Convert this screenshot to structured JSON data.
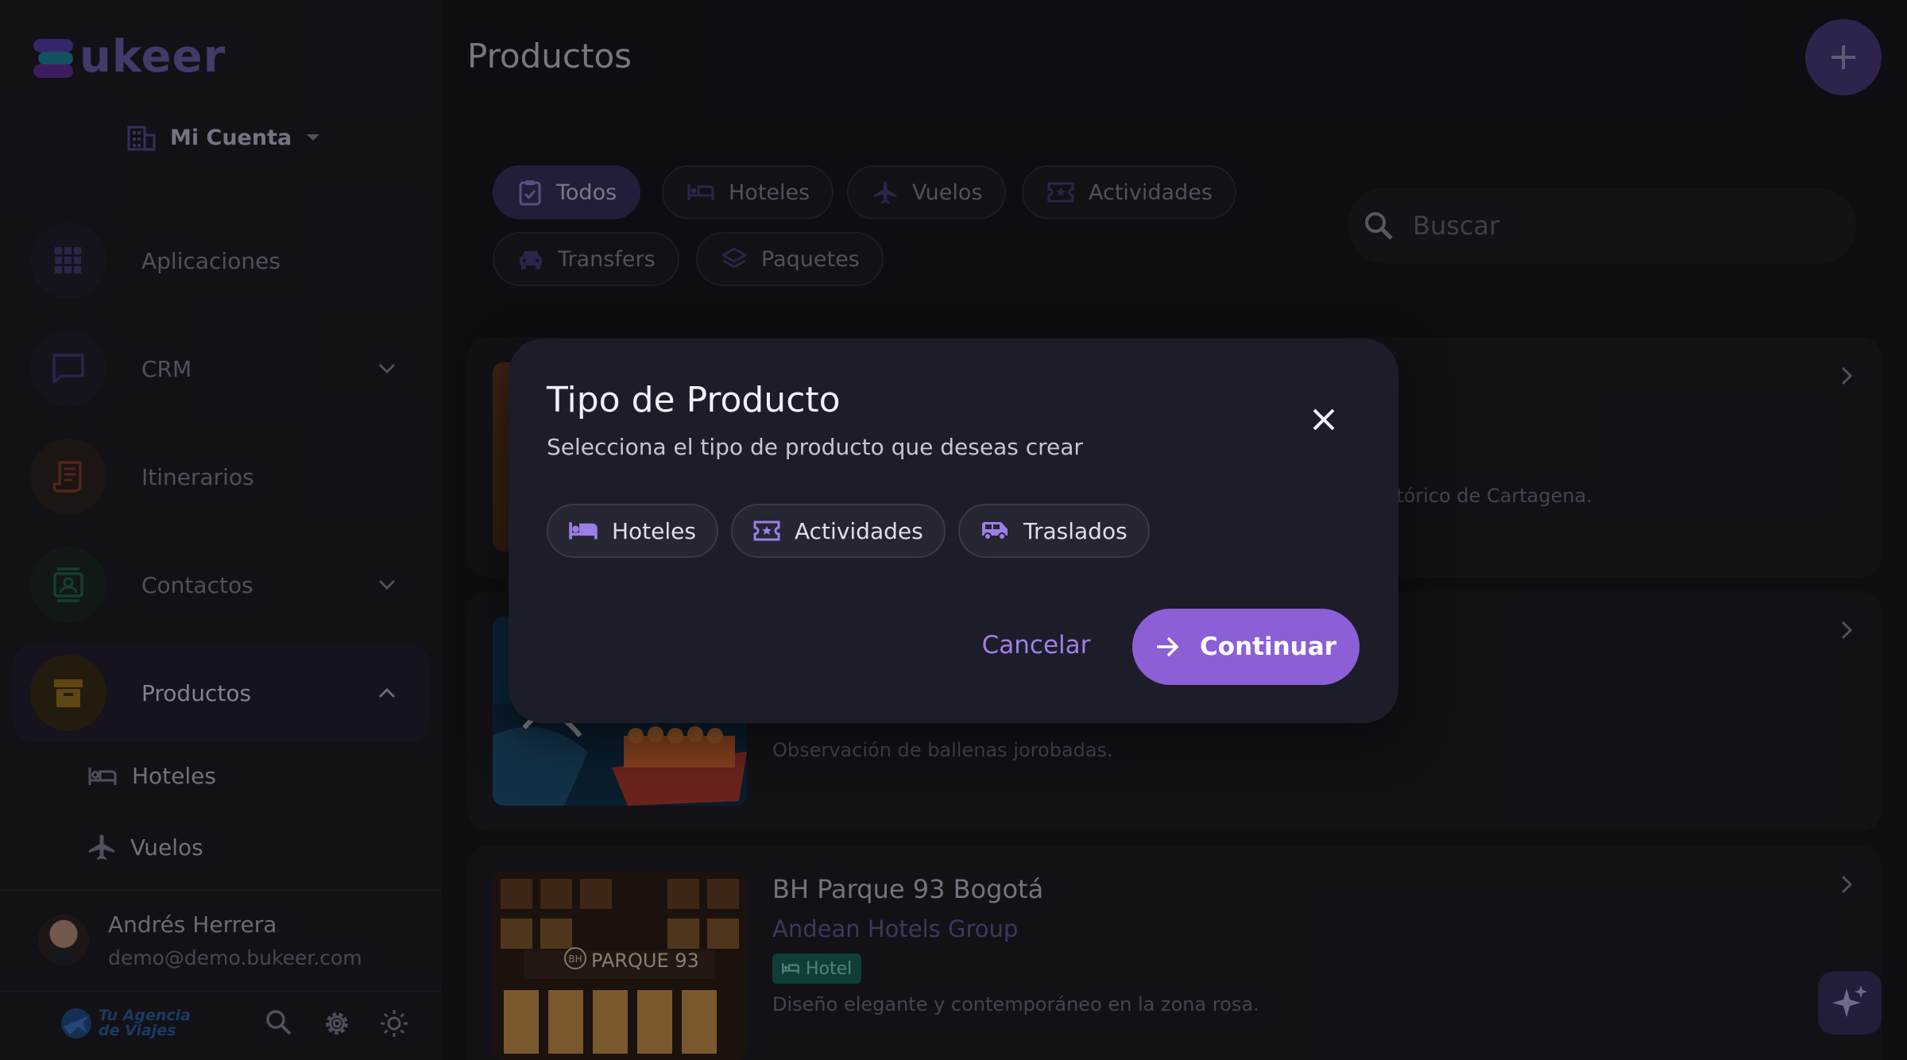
{
  "brand": {
    "name": "ukeer"
  },
  "account": {
    "label": "Mi Cuenta"
  },
  "nav": {
    "items": [
      {
        "label": "Aplicaciones"
      },
      {
        "label": "CRM"
      },
      {
        "label": "Itinerarios"
      },
      {
        "label": "Contactos"
      },
      {
        "label": "Productos"
      }
    ],
    "sub_items": [
      {
        "label": "Hoteles"
      },
      {
        "label": "Vuelos"
      }
    ]
  },
  "user": {
    "name": "Andrés Herrera",
    "email": "demo@demo.bukeer.com"
  },
  "agency": {
    "line1": "Tu Agencia",
    "line2": "de Viajes"
  },
  "page": {
    "title": "Productos"
  },
  "filters": [
    {
      "label": "Todos",
      "active": true
    },
    {
      "label": "Hoteles"
    },
    {
      "label": "Vuelos"
    },
    {
      "label": "Actividades"
    },
    {
      "label": "Transfers"
    },
    {
      "label": "Paquetes"
    }
  ],
  "search": {
    "placeholder": "Buscar"
  },
  "cards": [
    {
      "description_fragment": "istórico de Cartagena."
    },
    {
      "description": "Observación de ballenas jorobadas."
    },
    {
      "title": "BH Parque 93 Bogotá",
      "provider": "Andean Hotels Group",
      "badge": "Hotel",
      "description": "Diseño elegante y contemporáneo en la zona rosa.",
      "image_sign": "PARQUE 93",
      "image_logo": "BH"
    }
  ],
  "dialog": {
    "title": "Tipo de Producto",
    "subtitle": "Selecciona el tipo de producto que deseas crear",
    "options": [
      {
        "label": "Hoteles",
        "icon": "bed-icon"
      },
      {
        "label": "Actividades",
        "icon": "ticket-icon"
      },
      {
        "label": "Traslados",
        "icon": "van-icon"
      }
    ],
    "cancel_label": "Cancelar",
    "continue_label": "Continuar"
  },
  "colors": {
    "accent": "#8c5fd6",
    "sidebar": "#1a1920",
    "background": "#131218",
    "hotel_badge": "#136b5c"
  }
}
